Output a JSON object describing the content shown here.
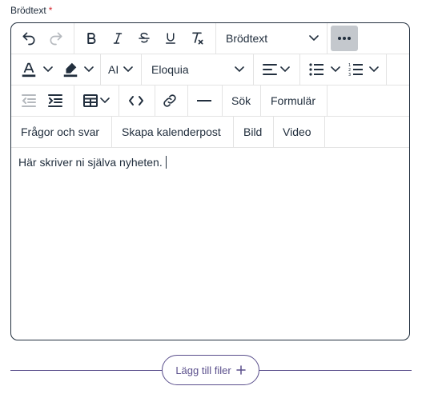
{
  "field": {
    "label": "Brödtext",
    "required_mark": "*"
  },
  "toolbar": {
    "block_format": "Brödtext",
    "ai_label": "AI",
    "font_family": "Eloquia",
    "search_label": "Sök",
    "form_label": "Formulär",
    "custom_buttons": [
      "Frågor och svar",
      "Skapa kalenderpost",
      "Bild",
      "Video"
    ]
  },
  "editor": {
    "content": "Här skriver ni själva nyheten."
  },
  "attach": {
    "label": "Lägg till filer"
  },
  "colors": {
    "text": "#222f3e",
    "accent": "#5a4f8c",
    "active": "#c4c8cd",
    "required": "#d6272f"
  }
}
